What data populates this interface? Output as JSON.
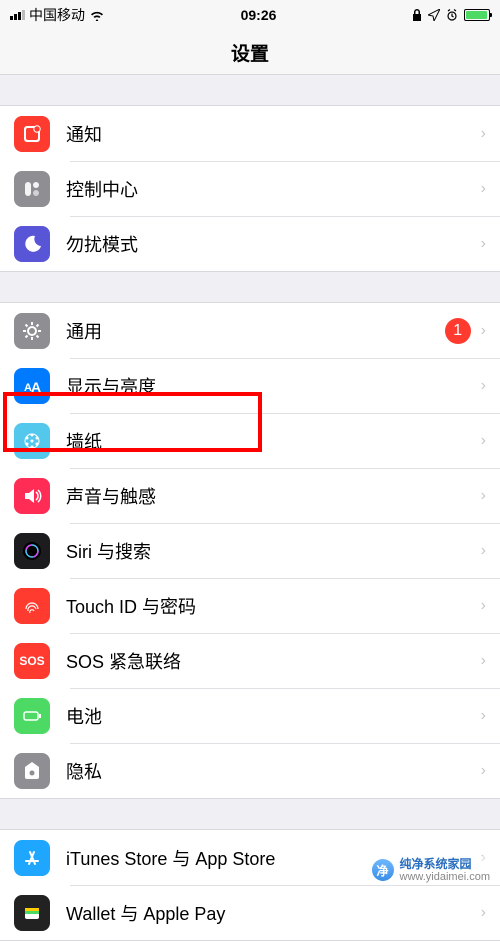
{
  "status": {
    "carrier": "中国移动",
    "time": "09:26"
  },
  "title": "设置",
  "groups": [
    {
      "items": [
        {
          "key": "notifications",
          "label": "通知"
        },
        {
          "key": "control_center",
          "label": "控制中心"
        },
        {
          "key": "dnd",
          "label": "勿扰模式"
        }
      ]
    },
    {
      "items": [
        {
          "key": "general",
          "label": "通用",
          "badge": "1"
        },
        {
          "key": "display",
          "label": "显示与亮度"
        },
        {
          "key": "wallpaper",
          "label": "墙纸"
        },
        {
          "key": "sound",
          "label": "声音与触感"
        },
        {
          "key": "siri",
          "label": "Siri 与搜索"
        },
        {
          "key": "touchid",
          "label": "Touch ID 与密码"
        },
        {
          "key": "sos",
          "label": "SOS 紧急联络",
          "icon_text": "SOS"
        },
        {
          "key": "battery",
          "label": "电池"
        },
        {
          "key": "privacy",
          "label": "隐私"
        }
      ]
    },
    {
      "items": [
        {
          "key": "store",
          "label": "iTunes Store 与 App Store"
        },
        {
          "key": "wallet",
          "label": "Wallet 与 Apple Pay"
        }
      ]
    }
  ],
  "watermark": {
    "line1": "纯净系统家园",
    "line2": "www.yidaimei.com"
  }
}
